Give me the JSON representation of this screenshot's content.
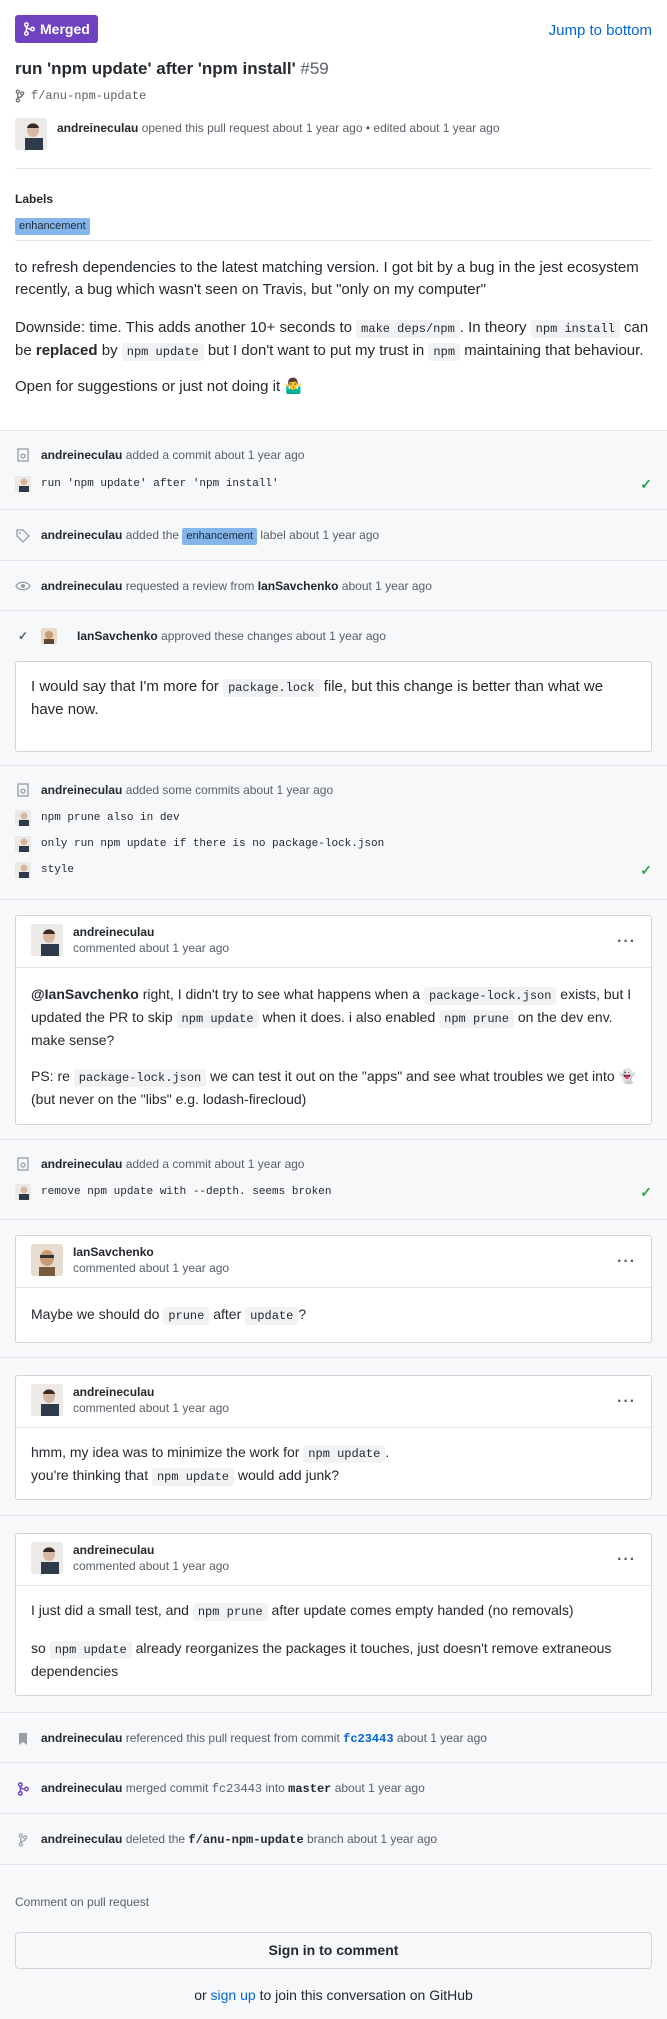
{
  "state_label": "Merged",
  "jump_label": "Jump to bottom",
  "title": "run 'npm update' after 'npm install'",
  "number": "#59",
  "branch": "f/anu-npm-update",
  "opener": {
    "user": "andreineculau",
    "text": " opened this pull request about 1 year ago • edited about 1 year ago"
  },
  "labels_heading": "Labels",
  "label": "enhancement",
  "description": {
    "p1": "to refresh dependencies to the latest matching version. I got bit by a bug in the jest ecosystem recently, a bug which wasn't seen on Travis, but \"only on my computer\"",
    "p2_a": "Downside: time. This adds another 10+ seconds to ",
    "p2_code1": "make deps/npm",
    "p2_b": ". In theory ",
    "p2_code2": "npm install",
    "p2_c": " can be ",
    "p2_bold": "replaced",
    "p2_d": " by ",
    "p2_code3": "npm update",
    "p2_e": " but I don't want to put my trust in ",
    "p2_code4": "npm",
    "p2_f": " maintaining that behaviour.",
    "p3": "Open for suggestions or just not doing it ",
    "p3_emoji": "🤷‍♂️"
  },
  "events": {
    "e1": {
      "user": "andreineculau",
      "text": " added a commit about 1 year ago",
      "commit": "run 'npm update' after 'npm install'"
    },
    "e2": {
      "user": "andreineculau",
      "text_a": " added the ",
      "label": "enhancement",
      "text_b": " label about 1 year ago"
    },
    "e3": {
      "user": "andreineculau",
      "text_a": " requested a review from ",
      "reviewer": "IanSavchenko",
      "text_b": " about 1 year ago"
    },
    "e4": {
      "user": "IanSavchenko",
      "text": " approved these changes about 1 year ago",
      "review_a": "I would say that I'm more for ",
      "review_code": "package.lock",
      "review_b": " file, but this change is better than what we have now."
    },
    "e5": {
      "user": "andreineculau",
      "text": " added some commits about 1 year ago",
      "commits": [
        "npm prune also in dev",
        "only run npm update if there is no package-lock.json",
        "style"
      ]
    },
    "e7": {
      "user": "andreineculau",
      "text": " added a commit about 1 year ago",
      "commit": "remove npm update with --depth. seems broken"
    },
    "e11": {
      "user": "andreineculau",
      "text_a": " referenced this pull request from commit ",
      "sha": "fc23443",
      "text_b": " about 1 year ago"
    },
    "e12": {
      "user": "andreineculau",
      "text_a": " merged commit ",
      "sha": "fc23443",
      "text_b": " into ",
      "target": "master",
      "text_c": " about 1 year ago"
    },
    "e13": {
      "user": "andreineculau",
      "text_a": " deleted the ",
      "branch": "f/anu-npm-update",
      "text_b": " branch about 1 year ago"
    }
  },
  "comments": {
    "c1": {
      "user": "andreineculau",
      "time": "commented about 1 year ago",
      "mention": "@IanSavchenko",
      "a": " right, I didn't try to see what happens when a ",
      "code1": "package-lock.json",
      "b": " exists, but I updated the PR to skip ",
      "code2": "npm update",
      "c": " when it does. i also enabled ",
      "code3": "npm prune",
      "d": " on the dev env. make sense?",
      "ps_a": "PS: re ",
      "ps_code": "package-lock.json",
      "ps_b": " we can test it out on the \"apps\" and see what troubles we get into ",
      "ps_emoji": "👻",
      "ps_c": " (but never on the \"libs\" e.g. lodash-firecloud)"
    },
    "c2": {
      "user": "IanSavchenko",
      "time": "commented about 1 year ago",
      "a": "Maybe we should do ",
      "code1": "prune",
      "b": " after ",
      "code2": "update",
      "c": "?"
    },
    "c3": {
      "user": "andreineculau",
      "time": "commented about 1 year ago",
      "a": "hmm, my idea was to minimize the work for ",
      "code1": "npm update",
      "b": ".",
      "c": "you're thinking that ",
      "code2": "npm update",
      "d": " would add junk?"
    },
    "c4": {
      "user": "andreineculau",
      "time": "commented about 1 year ago",
      "a": "I just did a small test, and ",
      "code1": "npm prune",
      "b": " after update comes empty handed (no removals)",
      "c": "so ",
      "code2": "npm update",
      "d": " already reorganizes the packages it touches, just doesn't remove extraneous dependencies"
    }
  },
  "footer": {
    "heading": "Comment on pull request",
    "sign_in": "Sign in to comment",
    "or": "or ",
    "sign_up": "sign up",
    "rest": " to join this conversation on GitHub"
  },
  "colors": {
    "merged": "#6f42c1",
    "link": "#0366d6",
    "label": "#84b6eb",
    "success": "#28a745"
  }
}
